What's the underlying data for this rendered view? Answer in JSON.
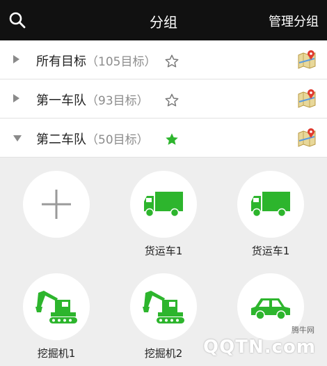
{
  "header": {
    "title": "分组",
    "manage_label": "管理分组"
  },
  "groups": [
    {
      "name": "所有目标",
      "count_text": "（105目标）",
      "favorite": false,
      "expanded": false
    },
    {
      "name": "第一车队",
      "count_text": "（93目标）",
      "favorite": false,
      "expanded": false
    },
    {
      "name": "第二车队",
      "count_text": "（50目标）",
      "favorite": true,
      "expanded": true
    }
  ],
  "vehicles": [
    {
      "label": "",
      "icon": "plus-icon"
    },
    {
      "label": "货运车1",
      "icon": "truck-icon"
    },
    {
      "label": "货运车1",
      "icon": "truck-icon"
    },
    {
      "label": "挖掘机1",
      "icon": "excavator-icon"
    },
    {
      "label": "挖掘机2",
      "icon": "excavator-icon"
    },
    {
      "label": "",
      "icon": "car-icon"
    }
  ],
  "colors": {
    "accent": "#2db52d",
    "header_bg": "#111111",
    "star_on": "#2db52d"
  },
  "watermark": {
    "small_text": "腾牛网",
    "text": "QQTN.com"
  }
}
